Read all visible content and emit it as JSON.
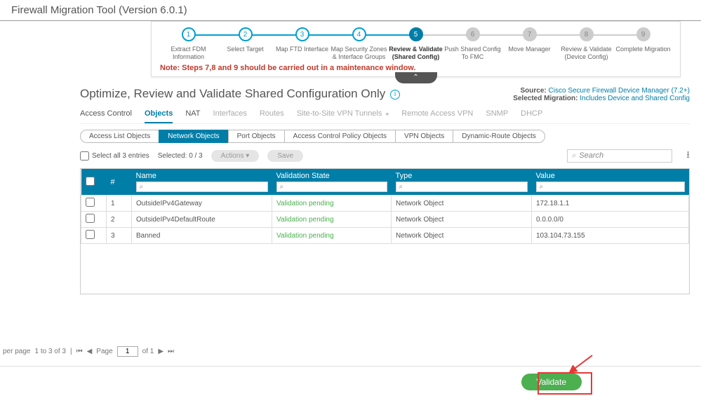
{
  "titlebar": "Firewall Migration Tool (Version 6.0.1)",
  "steps": [
    {
      "num": "1",
      "label": "Extract FDM Information",
      "state": "done"
    },
    {
      "num": "2",
      "label": "Select Target",
      "state": "done"
    },
    {
      "num": "3",
      "label": "Map FTD Interface",
      "state": "done"
    },
    {
      "num": "4",
      "label": "Map Security Zones & Interface Groups",
      "state": "done"
    },
    {
      "num": "5",
      "label": "Review & Validate (Shared Config)",
      "state": "active"
    },
    {
      "num": "6",
      "label": "Push Shared Config To FMC",
      "state": "future"
    },
    {
      "num": "7",
      "label": "Move Manager",
      "state": "future"
    },
    {
      "num": "8",
      "label": "Review & Validate (Device Config)",
      "state": "future"
    },
    {
      "num": "9",
      "label": "Complete Migration",
      "state": "future"
    }
  ],
  "note": "Note: Steps 7,8 and 9 should be carried out in a maintenance window.",
  "page_title": "Optimize, Review and Validate Shared Configuration Only",
  "meta": {
    "source_label": "Source:",
    "source_value": "Cisco Secure Firewall Device Manager (7.2+)",
    "mig_label": "Selected Migration:",
    "mig_value": "Includes Device and Shared Config"
  },
  "tabs": [
    {
      "label": "Access Control",
      "enabled": true,
      "active": false
    },
    {
      "label": "Objects",
      "enabled": true,
      "active": true
    },
    {
      "label": "NAT",
      "enabled": true,
      "active": false
    },
    {
      "label": "Interfaces",
      "enabled": false
    },
    {
      "label": "Routes",
      "enabled": false
    },
    {
      "label": "Site-to-Site VPN Tunnels",
      "enabled": false,
      "badge": true
    },
    {
      "label": "Remote Access VPN",
      "enabled": false
    },
    {
      "label": "SNMP",
      "enabled": false
    },
    {
      "label": "DHCP",
      "enabled": false
    }
  ],
  "subtabs": [
    {
      "label": "Access List Objects"
    },
    {
      "label": "Network Objects",
      "active": true
    },
    {
      "label": "Port Objects"
    },
    {
      "label": "Access Control Policy Objects"
    },
    {
      "label": "VPN Objects"
    },
    {
      "label": "Dynamic-Route Objects"
    }
  ],
  "controls": {
    "select_all": "Select all 3 entries",
    "selected": "Selected: 0 / 3",
    "actions": "Actions ▾",
    "save": "Save",
    "search_ph": "Search"
  },
  "thead": {
    "chk": "",
    "num": "#",
    "name": "Name",
    "vs": "Validation State",
    "type": "Type",
    "val": "Value"
  },
  "rows": [
    {
      "num": "1",
      "name": "OutsideIPv4Gateway",
      "vs": "Validation pending",
      "type": "Network Object",
      "val": "172.18.1.1"
    },
    {
      "num": "2",
      "name": "OutsideIPv4DefaultRoute",
      "vs": "Validation pending",
      "type": "Network Object",
      "val": "0.0.0.0/0"
    },
    {
      "num": "3",
      "name": "Banned",
      "vs": "Validation pending",
      "type": "Network Object",
      "val": "103.104.73.155"
    }
  ],
  "pager": {
    "per_page": "per page",
    "range": "1 to 3 of 3",
    "page_lbl": "Page",
    "page": "1",
    "of": "of 1"
  },
  "validate_btn": "Validate",
  "filter_glyph": "⌕"
}
